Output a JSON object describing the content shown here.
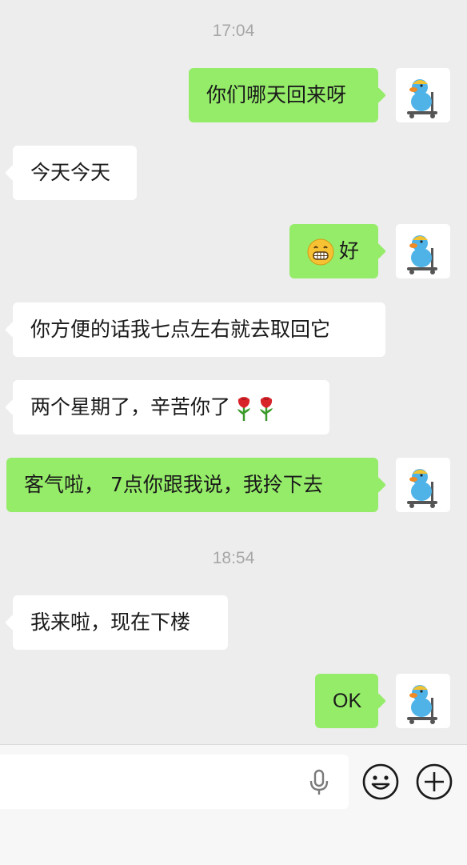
{
  "chat": {
    "timestamps": [
      "17:04",
      "18:54"
    ],
    "messages": [
      {
        "side": "out",
        "text": "你们哪天回来呀"
      },
      {
        "side": "in",
        "text": "今天今天"
      },
      {
        "side": "out",
        "emoji": "grin-emoji",
        "text": "好"
      },
      {
        "side": "in",
        "text": "你方便的话我七点左右就去取回它"
      },
      {
        "side": "in",
        "text": "两个星期了，辛苦你了",
        "trailing_emojis": [
          "rose-emoji",
          "rose-emoji"
        ]
      },
      {
        "side": "out",
        "text": "客气啦， 7点你跟我说，我拎下去"
      },
      {
        "side": "in",
        "text": "我来啦，现在下楼"
      },
      {
        "side": "out",
        "text": "OK"
      }
    ]
  },
  "input_bar": {
    "value": "",
    "icons": [
      "microphone-icon",
      "emoji-icon",
      "plus-icon"
    ]
  },
  "colors": {
    "background": "#ededed",
    "outgoing_bubble": "#95ec69",
    "incoming_bubble": "#ffffff",
    "timestamp": "#a7a7a7"
  }
}
